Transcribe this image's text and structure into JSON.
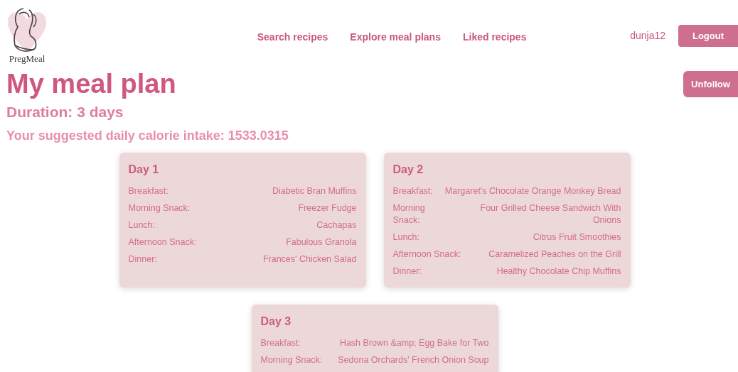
{
  "logo": {
    "text": "PregMeal"
  },
  "nav": [
    {
      "label": "Search recipes"
    },
    {
      "label": "Explore meal plans"
    },
    {
      "label": "Liked recipes"
    }
  ],
  "user": {
    "name": "dunja12",
    "logout": "Logout"
  },
  "title": "My meal plan",
  "duration": "Duration: 3 days",
  "calories": "Your suggested daily calorie intake: 1533.0315",
  "unfollow": "Unfollow",
  "days": [
    {
      "title": "Day 1",
      "meals": [
        {
          "label": "Breakfast:",
          "recipe": "Diabetic Bran Muffins"
        },
        {
          "label": "Morning Snack:",
          "recipe": "Freezer Fudge"
        },
        {
          "label": "Lunch:",
          "recipe": "Cachapas"
        },
        {
          "label": "Afternoon Snack:",
          "recipe": "Fabulous Granola"
        },
        {
          "label": "Dinner:",
          "recipe": "Frances' Chicken Salad"
        }
      ]
    },
    {
      "title": "Day 2",
      "meals": [
        {
          "label": "Breakfast:",
          "recipe": "Margaret's Chocolate Orange Monkey Bread"
        },
        {
          "label": "Morning Snack:",
          "recipe": "Four Grilled Cheese Sandwich With Onions"
        },
        {
          "label": "Lunch:",
          "recipe": "Citrus Fruit Smoothies"
        },
        {
          "label": "Afternoon Snack:",
          "recipe": "Caramelized Peaches on the Grill"
        },
        {
          "label": "Dinner:",
          "recipe": "Healthy Chocolate Chip Muffins"
        }
      ]
    },
    {
      "title": "Day 3",
      "meals": [
        {
          "label": "Breakfast:",
          "recipe": "Hash Brown &amp; Egg Bake for Two"
        },
        {
          "label": "Morning Snack:",
          "recipe": "Sedona Orchards' French Onion Soup"
        }
      ]
    }
  ]
}
